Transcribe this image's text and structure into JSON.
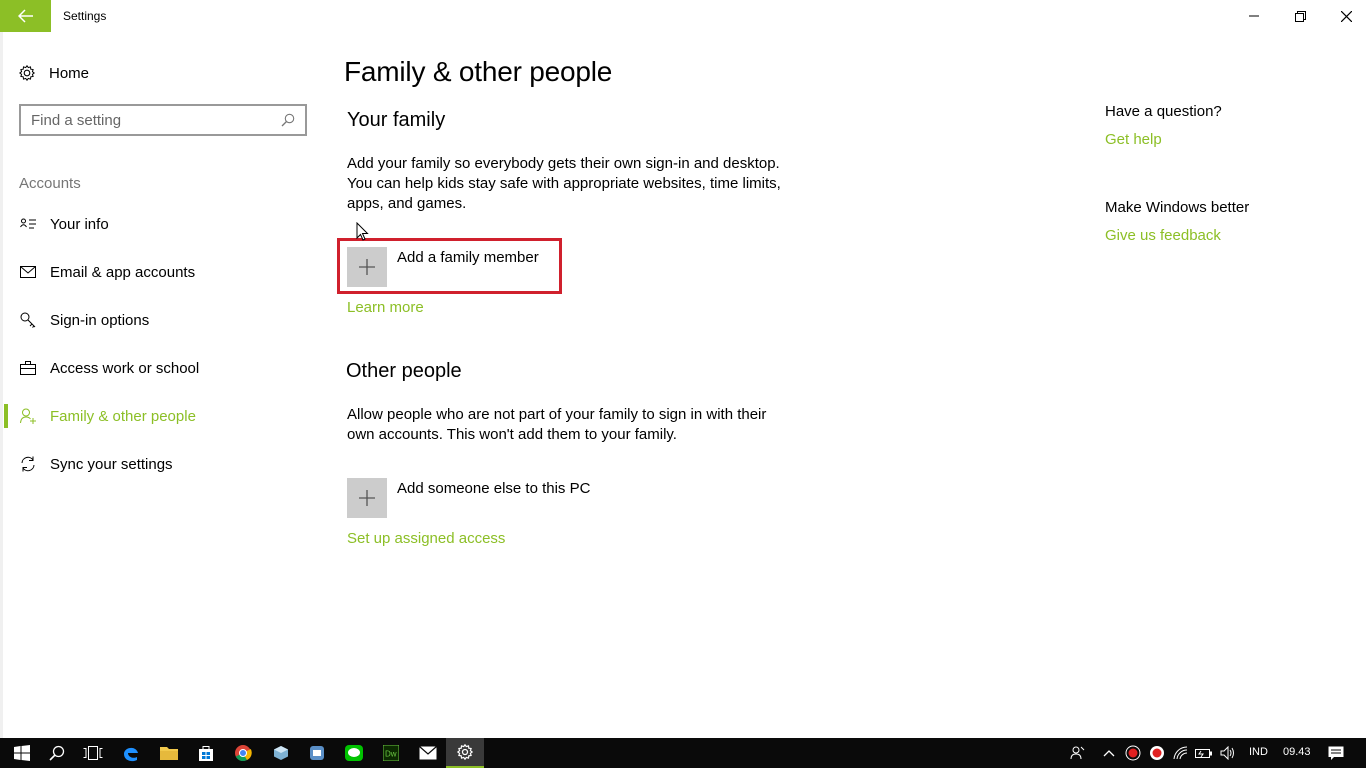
{
  "window": {
    "title": "Settings",
    "accent_color": "#8cbf26"
  },
  "sidebar": {
    "home_label": "Home",
    "search_placeholder": "Find a setting",
    "section_header": "Accounts",
    "items": [
      {
        "label": "Your info",
        "icon": "contact-card-icon"
      },
      {
        "label": "Email & app accounts",
        "icon": "mail-icon"
      },
      {
        "label": "Sign-in options",
        "icon": "key-icon"
      },
      {
        "label": "Access work or school",
        "icon": "briefcase-icon"
      },
      {
        "label": "Family & other people",
        "icon": "person-add-icon",
        "active": true
      },
      {
        "label": "Sync your settings",
        "icon": "sync-icon"
      }
    ]
  },
  "main": {
    "page_title": "Family & other people",
    "your_family": {
      "title": "Your family",
      "description": "Add your family so everybody gets their own sign-in and desktop. You can help kids stay safe with appropriate websites, time limits, apps, and games.",
      "add_button": "Add a family member",
      "learn_more": "Learn more"
    },
    "other_people": {
      "title": "Other people",
      "description": "Allow people who are not part of your family to sign in with their own accounts. This won't add them to your family.",
      "add_button": "Add someone else to this PC",
      "assigned_access": "Set up assigned access"
    }
  },
  "right_panel": {
    "question": "Have a question?",
    "get_help": "Get help",
    "make_better": "Make Windows better",
    "feedback": "Give us feedback"
  },
  "taskbar": {
    "language": "IND",
    "time": "09.43"
  }
}
